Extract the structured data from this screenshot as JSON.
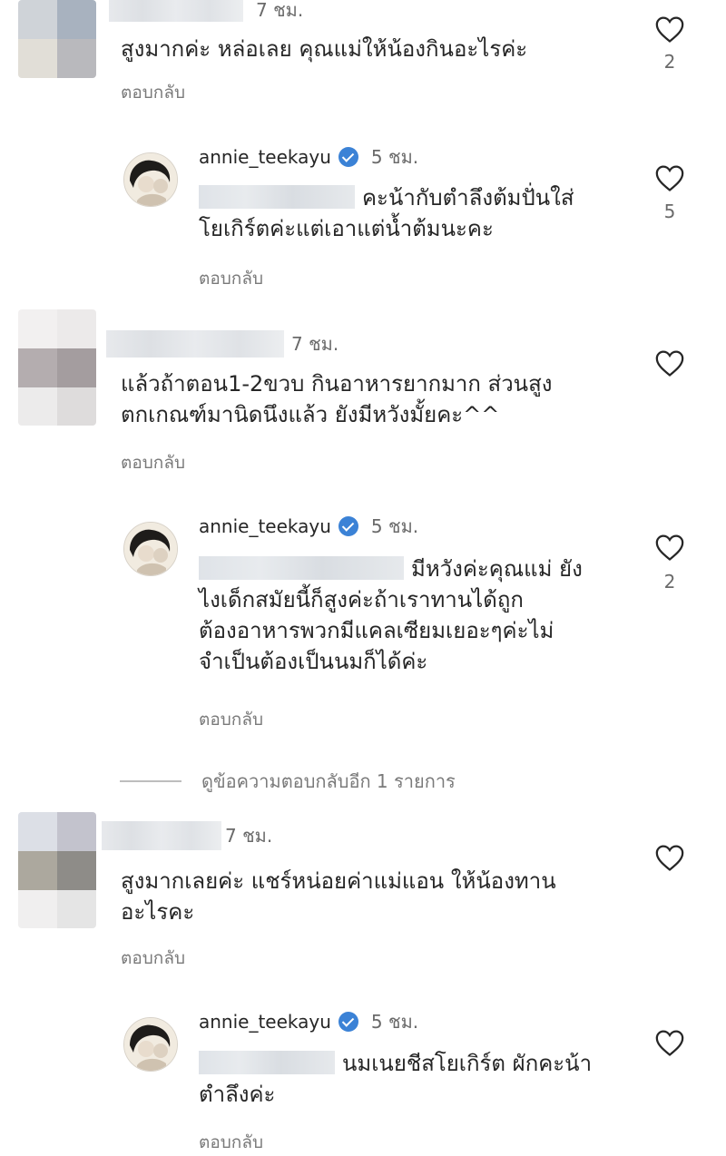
{
  "comments": [
    {
      "time": "7 ชม.",
      "text": "สูงมากค่ะ หล่อเลย คุณแม่ให้น้องกินอะไรค่ะ",
      "reply_label": "ตอบกลับ",
      "likes": "2"
    },
    {
      "username": "annie_teekayu",
      "time": "5 ชม.",
      "text_line1": "คะน้ากับตำลึงต้มปั่นใส่",
      "text_line2": "โยเกิร์ตค่ะแต่เอาแต่น้ำต้มนะคะ",
      "reply_label": "ตอบกลับ",
      "likes": "5"
    },
    {
      "time": "7 ชม.",
      "text_line1": "แล้วถ้าตอน1-2ขวบ กินอาหารยากมาก ส่วนสูง",
      "text_line2": "ตกเกณฑ์มานิดนึงแล้ว ยังมีหวังมั้ยคะ^^",
      "reply_label": "ตอบกลับ"
    },
    {
      "username": "annie_teekayu",
      "time": "5 ชม.",
      "text_line1": "มีหวังค่ะคุณแม่ ยัง",
      "text_line2": "ไงเด็กสมัยนี้ก็สูงค่ะถ้าเราทานได้ถูก",
      "text_line3": "ต้องอาหารพวกมีแคลเซียมเยอะๆค่ะไม่",
      "text_line4": "จำเป็นต้องเป็นนมก็ได้ค่ะ",
      "reply_label": "ตอบกลับ",
      "likes": "2"
    },
    {
      "time": "7 ชม.",
      "text_line1": "สูงมากเลยค่ะ แชร์หน่อยค่าแม่แอน ให้น้องทาน",
      "text_line2": "อะไรคะ",
      "reply_label": "ตอบกลับ"
    },
    {
      "username": "annie_teekayu",
      "time": "5 ชม.",
      "text_line1": "นมเนยชีสโยเกิร์ต ผักคะน้า",
      "text_line2": "ตำลึงค่ะ",
      "reply_label": "ตอบกลับ"
    }
  ],
  "view_more_replies": "ดูข้อความตอบกลับอีก 1 รายการ",
  "icons": {
    "like": "heart-outline-icon",
    "verified": "verified-badge-icon"
  },
  "colors": {
    "verified": "#3b82d6",
    "text": "#262626",
    "muted": "#7a7a7a"
  }
}
